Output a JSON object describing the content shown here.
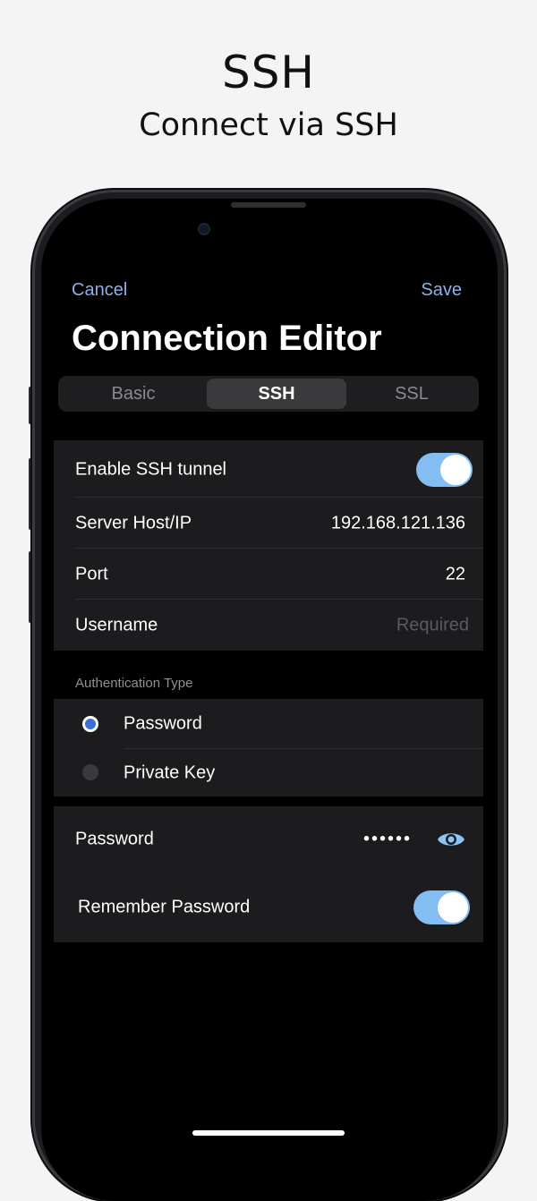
{
  "promo": {
    "title": "SSH",
    "subtitle": "Connect via SSH"
  },
  "nav": {
    "cancel_label": "Cancel",
    "save_label": "Save",
    "title": "Connection Editor"
  },
  "tabs": [
    {
      "label": "Basic",
      "selected": false
    },
    {
      "label": "SSH",
      "selected": true
    },
    {
      "label": "SSL",
      "selected": false
    }
  ],
  "ssh_settings": {
    "enable_label": "Enable SSH tunnel",
    "enabled": true,
    "host_label": "Server Host/IP",
    "host_value": "192.168.121.136",
    "port_label": "Port",
    "port_value": "22",
    "username_label": "Username",
    "username_placeholder": "Required"
  },
  "auth": {
    "header": "Authentication Type",
    "options": [
      {
        "label": "Password",
        "selected": true
      },
      {
        "label": "Private Key",
        "selected": false
      }
    ]
  },
  "password": {
    "label": "Password",
    "masked_value": "••••••",
    "reveal_icon": "eye-icon",
    "remember_label": "Remember Password",
    "remember": true
  },
  "colors": {
    "accent": "#8db1e6",
    "toggle_on": "#84bdf2",
    "radio_selected": "#3b6fd6"
  }
}
